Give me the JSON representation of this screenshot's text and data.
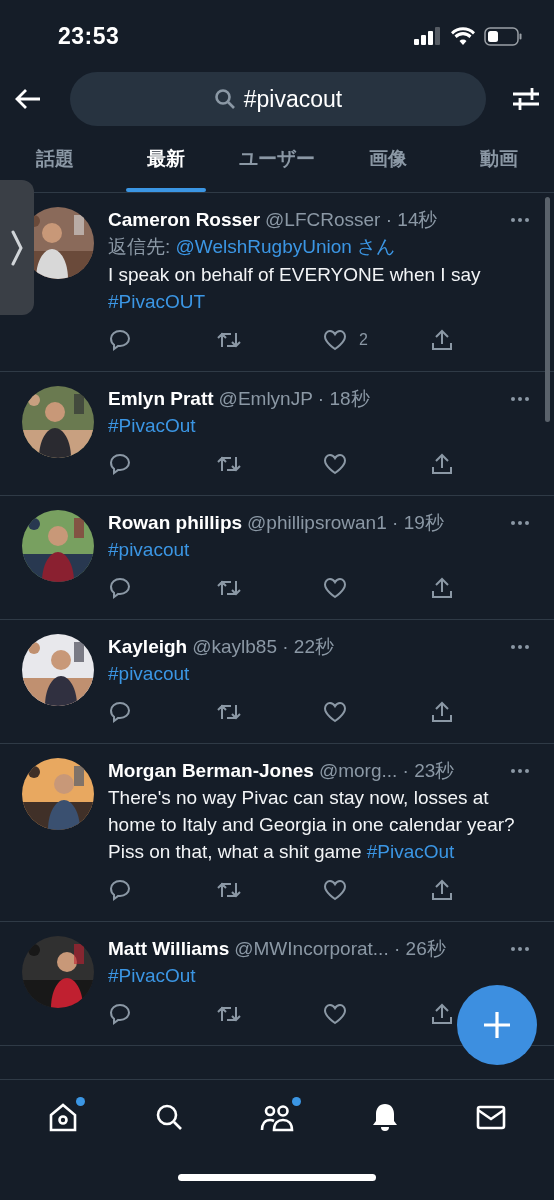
{
  "status_bar": {
    "time": "23:53"
  },
  "search": {
    "query": "#pivacout"
  },
  "tabs": [
    {
      "label": "話題",
      "selected": false
    },
    {
      "label": "最新",
      "selected": true
    },
    {
      "label": "ユーザー",
      "selected": false
    },
    {
      "label": "画像",
      "selected": false
    },
    {
      "label": "動画",
      "selected": false
    }
  ],
  "tweets": [
    {
      "name": "Cameron Rosser",
      "meta": "@LFCRosser · 14秒",
      "reply_to": {
        "prefix": "返信先:",
        "mention": "@WelshRugbyUnion さん"
      },
      "body": [
        {
          "kind": "text",
          "text": "I speak on behalf of EVERYONE when I say"
        },
        {
          "kind": "hashtag",
          "text": "#PivacOUT"
        }
      ],
      "like_count": "2"
    },
    {
      "name": "Emlyn Pratt",
      "meta": "@EmlynJP · 18秒",
      "body": [
        {
          "kind": "hashtag",
          "text": "#PivacOut"
        }
      ]
    },
    {
      "name": "Rowan phillips",
      "meta": "@phillipsrowan1 · 19秒",
      "body": [
        {
          "kind": "hashtag",
          "text": "#pivacout"
        }
      ]
    },
    {
      "name": "Kayleigh",
      "meta": "@kaylb85 · 22秒",
      "body": [
        {
          "kind": "hashtag",
          "text": "#pivacout"
        }
      ]
    },
    {
      "name": "Morgan Berman-Jones",
      "meta": "@morg... · 23秒",
      "body": [
        {
          "kind": "text",
          "text": "There's no way Pivac can stay now, losses at home to Italy and Georgia in one calendar year? Piss on that, what a shit game"
        },
        {
          "kind": "hashtag",
          "text": "#PivacOut"
        }
      ]
    },
    {
      "name": "Matt Williams",
      "meta": "@MWIncorporat... · 26秒",
      "body": [
        {
          "kind": "hashtag",
          "text": "#PivacOut"
        }
      ]
    }
  ],
  "nav": [
    {
      "kind": "home",
      "badge": true
    },
    {
      "kind": "search",
      "badge": false
    },
    {
      "kind": "communities",
      "badge": true
    },
    {
      "kind": "notifications",
      "badge": false
    },
    {
      "kind": "messages",
      "badge": false
    }
  ]
}
